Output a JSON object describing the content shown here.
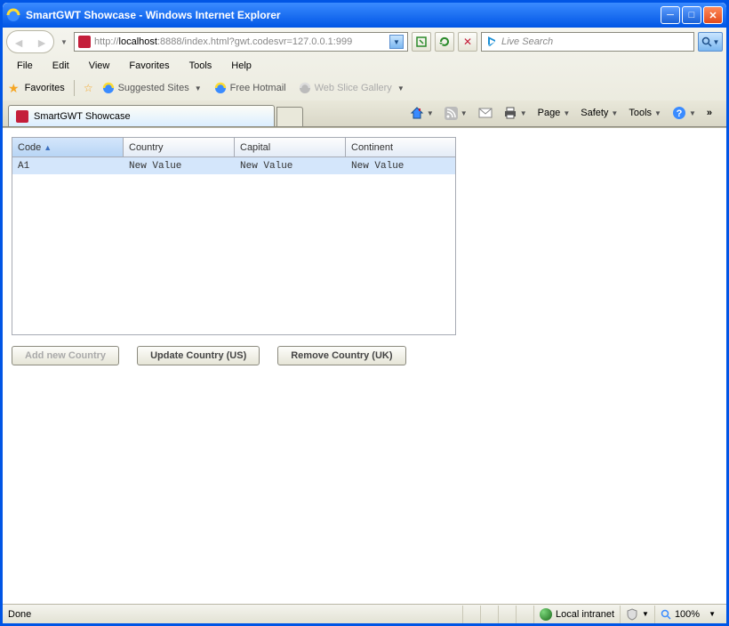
{
  "window": {
    "title": "SmartGWT Showcase - Windows Internet Explorer"
  },
  "address": {
    "scheme": "http://",
    "host": "localhost",
    "port_path": ":8888/index.html?gwt.codesvr=127.0.0.1:999"
  },
  "search": {
    "placeholder": "Live Search"
  },
  "menu": {
    "file": "File",
    "edit": "Edit",
    "view": "View",
    "favorites": "Favorites",
    "tools": "Tools",
    "help": "Help"
  },
  "favbar": {
    "label": "Favorites",
    "suggested": "Suggested Sites",
    "hotmail": "Free Hotmail",
    "slice": "Web Slice Gallery"
  },
  "tab": {
    "title": "SmartGWT Showcase"
  },
  "cmdbar": {
    "page": "Page",
    "safety": "Safety",
    "tools": "Tools"
  },
  "grid": {
    "headers": {
      "code": "Code",
      "country": "Country",
      "capital": "Capital",
      "continent": "Continent"
    },
    "rows": [
      {
        "code": "A1",
        "country": "New Value",
        "capital": "New Value",
        "continent": "New Value"
      }
    ]
  },
  "buttons": {
    "add": "Add new Country",
    "update": "Update Country (US)",
    "remove": "Remove Country (UK)"
  },
  "status": {
    "done": "Done",
    "zone": "Local intranet",
    "zoom": "100%"
  }
}
